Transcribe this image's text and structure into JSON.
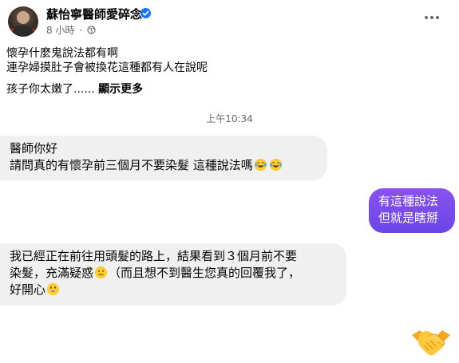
{
  "post": {
    "author": "蘇怡寧醫師愛碎念",
    "time": "8 小時",
    "separator": "·",
    "lines": [
      "懷孕什麼鬼說法都有啊",
      "連孕婦摸肚子會被換花這種都有人在說呢",
      "孩子你太嫩了......"
    ],
    "see_more": "顯示更多"
  },
  "chat": {
    "timestamp": "上午10:34",
    "messages": [
      {
        "side": "incoming",
        "lines": [
          "醫師你好",
          "請問真的有懷孕前三個月不要染髮 這種說法嗎"
        ],
        "trailing_emoji": [
          "laughing-tears-emoji",
          "laughing-tears-emoji"
        ]
      },
      {
        "side": "outgoing",
        "lines": [
          "有這種說法",
          "但就是瞎掰"
        ]
      },
      {
        "side": "incoming",
        "lines": [
          "我已經正在前往用頭髮的路上，結果看到３個月前不要",
          "染髮，充滿疑惑",
          "（而且想不到醫生您真的回覆我了，",
          "好開心"
        ],
        "emoji": [
          "confused-emoji",
          "grinning-emoji"
        ]
      }
    ],
    "reaction": "handshake-emoji"
  },
  "colors": {
    "outgoing_bubble": "#7a4ff0",
    "incoming_bubble": "#f0f0f0",
    "verified": "#1877f2",
    "meta_text": "#65676b"
  }
}
